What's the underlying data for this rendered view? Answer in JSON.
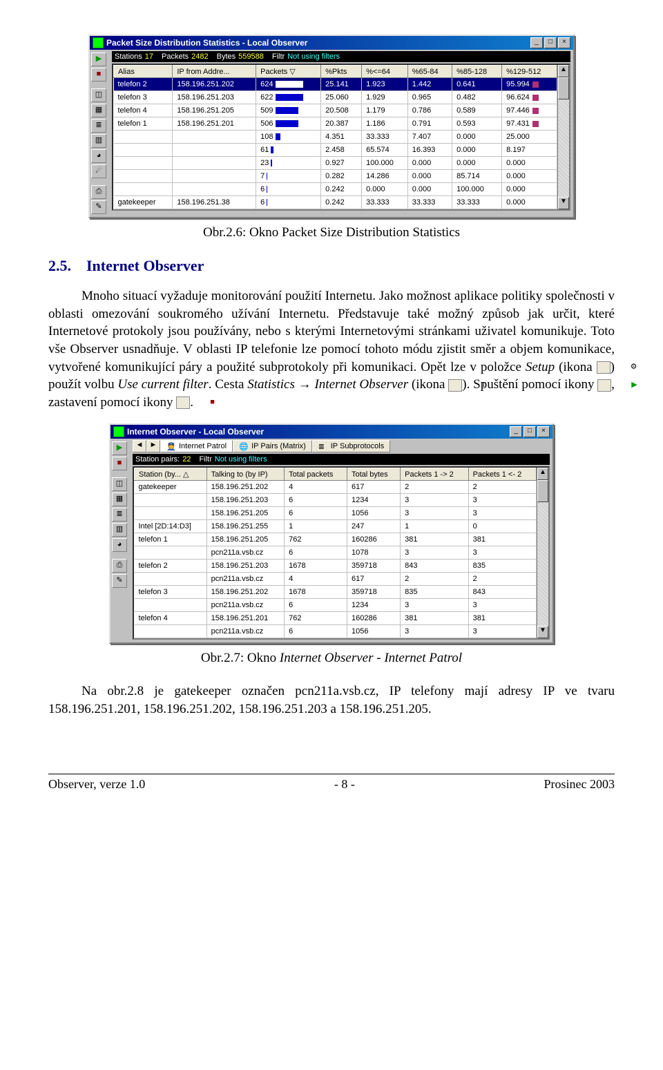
{
  "fig1": {
    "caption": "Obr.2.6: Okno Packet Size Distribution Statistics",
    "title": "Packet Size Distribution Statistics - Local Observer",
    "stats": {
      "stations_label": "Stations",
      "stations_value": "17",
      "packets_label": "Packets",
      "packets_value": "2482",
      "bytes_label": "Bytes",
      "bytes_value": "559588",
      "filter_label": "Filtr",
      "filter_value": "Not using filters"
    },
    "columns": [
      "Alias",
      "IP from Addre...",
      "Packets  ▽",
      "%Pkts",
      "%<=64",
      "%65-84",
      "%85-128",
      "%129-512"
    ],
    "rows": [
      {
        "alias": "telefon 2",
        "ip": "158.196.251.202",
        "packets": "624",
        "bar": 40,
        "pkts": "25.141",
        "c1": "1.923",
        "c2": "1.442",
        "c3": "0.641",
        "c4": "95.994",
        "sel": true,
        "mark": true
      },
      {
        "alias": "telefon 3",
        "ip": "158.196.251.203",
        "packets": "622",
        "bar": 40,
        "pkts": "25.060",
        "c1": "1.929",
        "c2": "0.965",
        "c3": "0.482",
        "c4": "96.624",
        "mark": true
      },
      {
        "alias": "telefon 4",
        "ip": "158.196.251.205",
        "packets": "509",
        "bar": 33,
        "pkts": "20.508",
        "c1": "1.179",
        "c2": "0.786",
        "c3": "0.589",
        "c4": "97.446",
        "mark": true
      },
      {
        "alias": "telefon 1",
        "ip": "158.196.251.201",
        "packets": "506",
        "bar": 33,
        "pkts": "20.387",
        "c1": "1.186",
        "c2": "0.791",
        "c3": "0.593",
        "c4": "97.431",
        "mark": true
      },
      {
        "alias": "",
        "ip": "",
        "packets": "108",
        "bar": 7,
        "pkts": "4.351",
        "c1": "33.333",
        "c2": "7.407",
        "c3": "0.000",
        "c4": "25.000"
      },
      {
        "alias": "",
        "ip": "",
        "packets": "61",
        "bar": 4,
        "pkts": "2.458",
        "c1": "65.574",
        "c2": "16.393",
        "c3": "0.000",
        "c4": "8.197"
      },
      {
        "alias": "",
        "ip": "",
        "packets": "23",
        "bar": 2,
        "pkts": "0.927",
        "c1": "100.000",
        "c2": "0.000",
        "c3": "0.000",
        "c4": "0.000"
      },
      {
        "alias": "",
        "ip": "",
        "packets": "7",
        "bar": 1,
        "pkts": "0.282",
        "c1": "14.286",
        "c2": "0.000",
        "c3": "85.714",
        "c4": "0.000"
      },
      {
        "alias": "",
        "ip": "",
        "packets": "6",
        "bar": 1,
        "pkts": "0.242",
        "c1": "0.000",
        "c2": "0.000",
        "c3": "100.000",
        "c4": "0.000"
      },
      {
        "alias": "gatekeeper",
        "ip": "158.196.251.38",
        "packets": "6",
        "bar": 1,
        "pkts": "0.242",
        "c1": "33.333",
        "c2": "33.333",
        "c3": "33.333",
        "c4": "0.000"
      }
    ]
  },
  "section": {
    "num": "2.5.",
    "title": "Internet Observer"
  },
  "paragraph": {
    "t1": "Mnoho situací vyžaduje monitorování použití Internetu. Jako možnost aplikace politiky společnosti v oblasti omezování soukromého užívání Internetu. Představuje také možný způsob jak určit, které Internetové protokoly jsou používány, nebo s kterými Internetovými stránkami uživatel komunikuje. Toto vše Observer usnadňuje. V oblasti IP telefonie lze pomocí tohoto módu zjistit směr a objem komunikace, vytvořené komunikující páry a použité subprotokoly při komunikaci. Opět lze v položce ",
    "setup": "Setup",
    "t2": " (ikona ",
    "t3": ") použít volbu ",
    "usecurrent": "Use current filter",
    "t4": ". Cesta ",
    "statistics": "Statistics",
    "arrow": " → ",
    "io": "Internet Observer",
    "t5": " (ikona ",
    "t6": "). Spuštění pomocí ikony ",
    "t7": ", zastavení pomocí ikony ",
    "t8": "."
  },
  "fig2": {
    "caption": "Obr.2.7: Okno Internet Observer - Internet Patrol",
    "title": "Internet Observer - Local Observer",
    "tabs": {
      "t1": "Internet Patrol",
      "t2": "IP Pairs (Matrix)",
      "t3": "IP Subprotocols"
    },
    "stats": {
      "pairs_label": "Station pairs:",
      "pairs_value": "22",
      "filter_label": "Filtr",
      "filter_value": "Not using filters"
    },
    "columns": [
      "Station (by...  △",
      "Talking to (by IP)",
      "Total packets",
      "Total bytes",
      "Packets 1 -> 2",
      "Packets 1 <- 2"
    ],
    "rows": [
      {
        "a": "gatekeeper",
        "b": "158.196.251.202",
        "tp": "4",
        "tb": "617",
        "p12": "2",
        "p21": "2"
      },
      {
        "a": "",
        "b": "158.196.251.203",
        "tp": "6",
        "tb": "1234",
        "p12": "3",
        "p21": "3"
      },
      {
        "a": "",
        "b": "158.196.251.205",
        "tp": "6",
        "tb": "1056",
        "p12": "3",
        "p21": "3"
      },
      {
        "a": "Intel [2D:14:D3]",
        "b": "158.196.251.255",
        "tp": "1",
        "tb": "247",
        "p12": "1",
        "p21": "0"
      },
      {
        "a": "telefon 1",
        "b": "158.196.251.205",
        "tp": "762",
        "tb": "160286",
        "p12": "381",
        "p21": "381"
      },
      {
        "a": "",
        "b": "pcn211a.vsb.cz",
        "tp": "6",
        "tb": "1078",
        "p12": "3",
        "p21": "3"
      },
      {
        "a": "telefon 2",
        "b": "158.196.251.203",
        "tp": "1678",
        "tb": "359718",
        "p12": "843",
        "p21": "835"
      },
      {
        "a": "",
        "b": "pcn211a.vsb.cz",
        "tp": "4",
        "tb": "617",
        "p12": "2",
        "p21": "2"
      },
      {
        "a": "telefon 3",
        "b": "158.196.251.202",
        "tp": "1678",
        "tb": "359718",
        "p12": "835",
        "p21": "843"
      },
      {
        "a": "",
        "b": "pcn211a.vsb.cz",
        "tp": "6",
        "tb": "1234",
        "p12": "3",
        "p21": "3"
      },
      {
        "a": "telefon 4",
        "b": "158.196.251.201",
        "tp": "762",
        "tb": "160286",
        "p12": "381",
        "p21": "381"
      },
      {
        "a": "",
        "b": "pcn211a.vsb.cz",
        "tp": "6",
        "tb": "1056",
        "p12": "3",
        "p21": "3"
      }
    ]
  },
  "tail": "Na obr.2.8 je gatekeeper označen pcn211a.vsb.cz, IP telefony mají adresy IP ve tvaru 158.196.251.201, 158.196.251.202, 158.196.251.203 a 158.196.251.205.",
  "footer": {
    "left": "Observer, verze 1.0",
    "center": "- 8 -",
    "right": "Prosinec 2003"
  }
}
